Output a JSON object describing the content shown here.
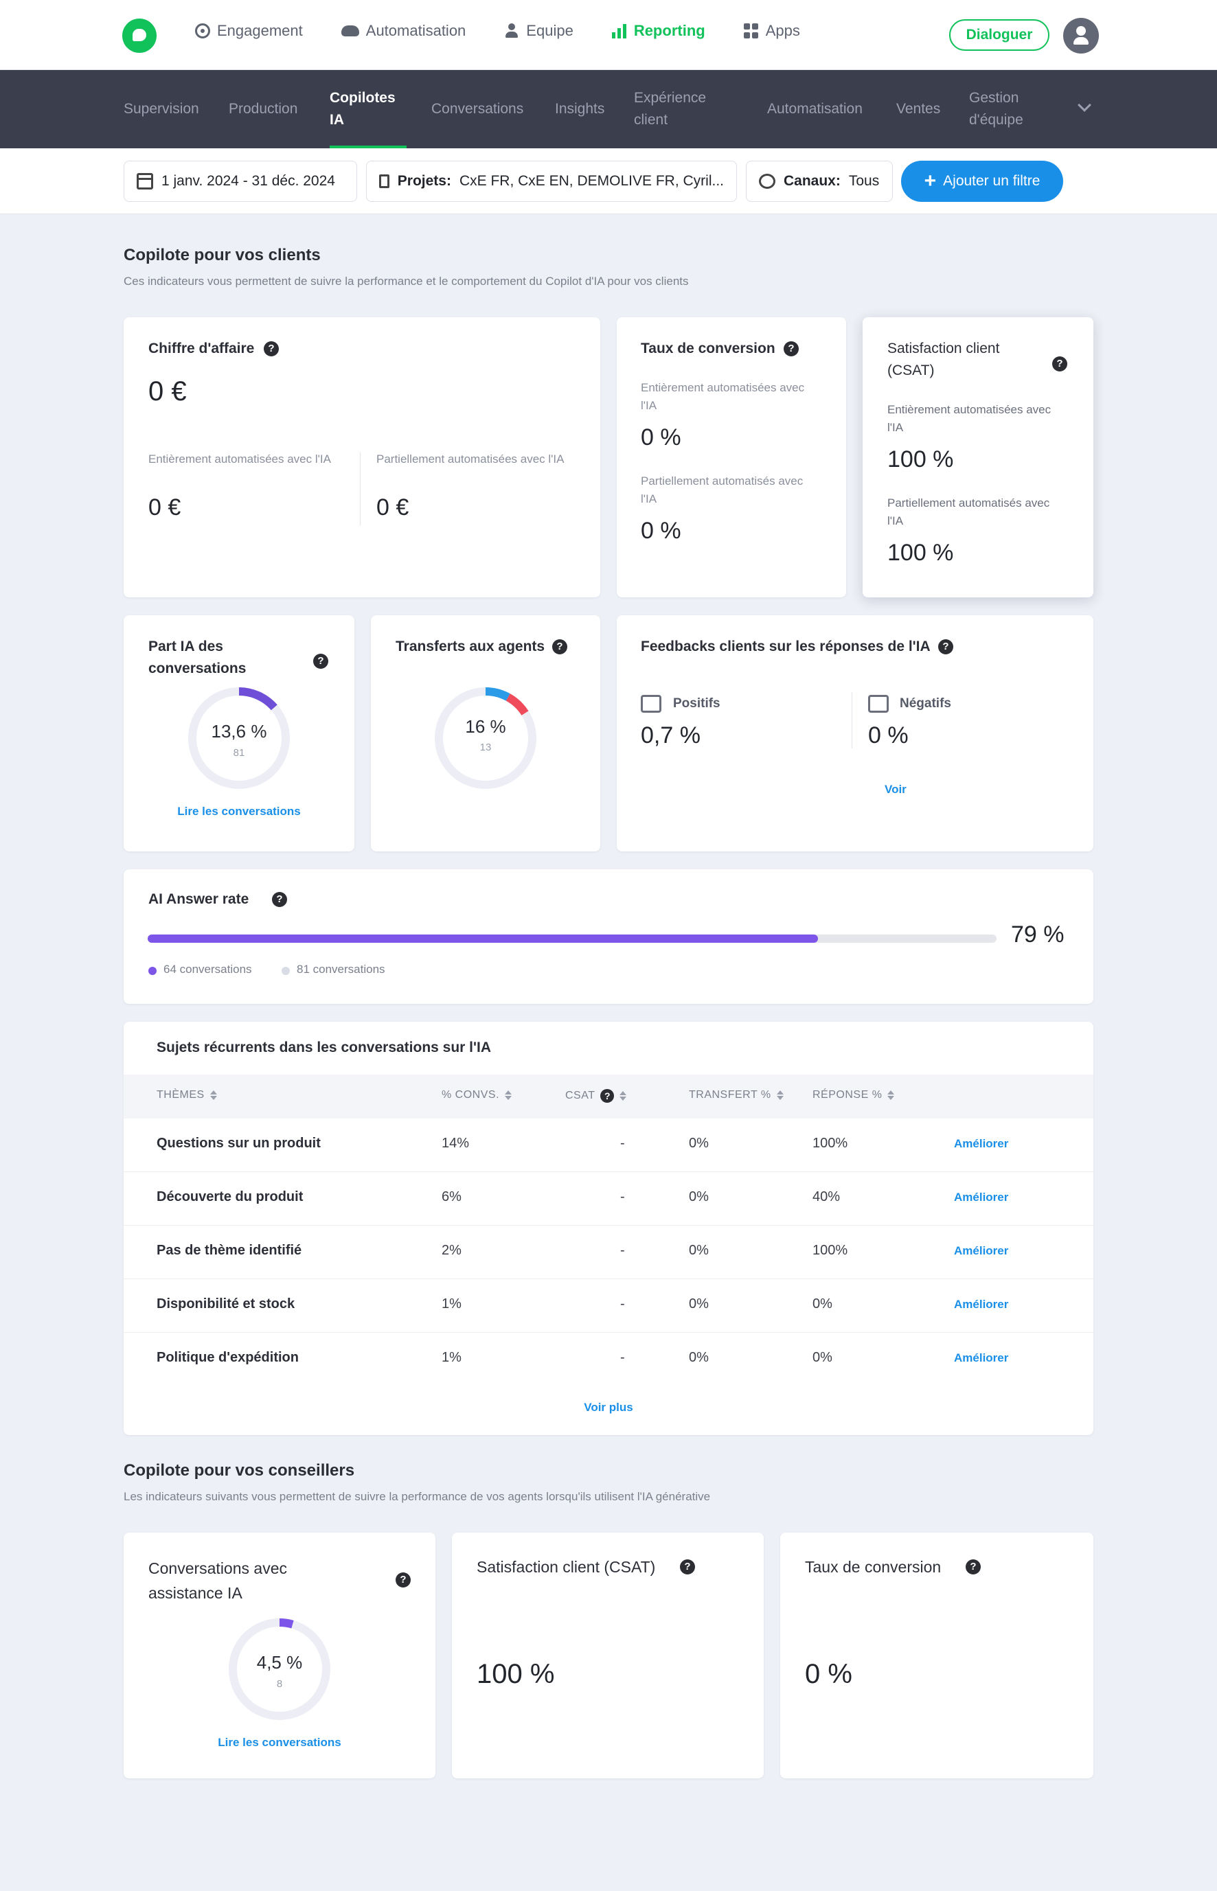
{
  "topnav": {
    "items": [
      {
        "label": "Engagement",
        "icon": "target-icon"
      },
      {
        "label": "Automatisation",
        "icon": "cloud-icon"
      },
      {
        "label": "Equipe",
        "icon": "user-icon"
      },
      {
        "label": "Reporting",
        "icon": "bar-chart-icon",
        "active": true
      },
      {
        "label": "Apps",
        "icon": "apps-grid-icon"
      }
    ],
    "dialoguer": "Dialoguer",
    "accent": "#11c25a"
  },
  "subnav": {
    "items": [
      {
        "label": "Supervision"
      },
      {
        "label": "Production"
      },
      {
        "label": "Copilotes IA",
        "active": true
      },
      {
        "label": "Conversations"
      },
      {
        "label": "Insights"
      },
      {
        "label": "Expérience client"
      },
      {
        "label": "Automatisation"
      },
      {
        "label": "Ventes"
      },
      {
        "label": "Gestion d'équipe"
      }
    ]
  },
  "filters": {
    "date": "1 janv. 2024 - 31 déc. 2024",
    "projects_label": "Projets:",
    "projects_value": "CxE FR, CxE EN, DEMOLIVE FR, Cyril...",
    "channels_label": "Canaux:",
    "channels_value": "Tous",
    "add": "Ajouter un filtre"
  },
  "clients": {
    "title": "Copilote pour vos clients",
    "subtitle": "Ces indicateurs vous permettent de suivre la performance et le comportement du Copilot d'IA pour vos clients",
    "revenue": {
      "title": "Chiffre d'affaire",
      "total": "0 €",
      "full_label": "Entièrement automatisées avec l'IA",
      "full_value": "0 €",
      "partial_label": "Partiellement automatisées avec l'IA",
      "partial_value": "0 €"
    },
    "conversion": {
      "title": "Taux de conversion",
      "full_label": "Entièrement automatisées avec l'IA",
      "full_value": "0 %",
      "partial_label": "Partiellement automatisés avec l'IA",
      "partial_value": "0 %"
    },
    "csat": {
      "title": "Satisfaction client (CSAT)",
      "full_label": "Entièrement automatisées avec l'IA",
      "full_value": "100 %",
      "partial_label": "Partiellement automatisés avec l'IA",
      "partial_value": "100 %"
    },
    "ai_share": {
      "title": "Part IA des conversations",
      "value": "13,6 %",
      "count": "81",
      "percent": 13.6,
      "color": "#6f4fd8",
      "link": "Lire les conversations"
    },
    "transfers": {
      "title": "Transferts aux agents",
      "value": "16 %",
      "count": "13",
      "segments": [
        {
          "percent": 8,
          "color": "#2b9be8"
        },
        {
          "percent": 8,
          "color": "#ef4b5a"
        }
      ]
    },
    "feedback": {
      "title": "Feedbacks clients sur les réponses de l'IA",
      "positive_label": "Positifs",
      "positive_value": "0,7 %",
      "negative_label": "Négatifs",
      "negative_value": "0 %",
      "link": "Voir"
    },
    "answer_rate": {
      "title": "AI Answer rate",
      "value": "79 %",
      "percent": 79,
      "legend_answered": "64 conversations",
      "legend_total": "81 conversations",
      "fill_color": "#7d55e8"
    }
  },
  "topics": {
    "title": "Sujets récurrents dans les conversations sur l'IA",
    "columns": [
      "THÈMES",
      "% CONVS.",
      "CSAT",
      "TRANSFERT %",
      "RÉPONSE %"
    ],
    "rows": [
      {
        "theme": "Questions sur un produit",
        "convs": "14%",
        "csat": "-",
        "transfer": "0%",
        "response": "100%",
        "action": "Améliorer"
      },
      {
        "theme": "Découverte du produit",
        "convs": "6%",
        "csat": "-",
        "transfer": "0%",
        "response": "40%",
        "action": "Améliorer"
      },
      {
        "theme": "Pas de thème identifié",
        "convs": "2%",
        "csat": "-",
        "transfer": "0%",
        "response": "100%",
        "action": "Améliorer"
      },
      {
        "theme": "Disponibilité et stock",
        "convs": "1%",
        "csat": "-",
        "transfer": "0%",
        "response": "0%",
        "action": "Améliorer"
      },
      {
        "theme": "Politique d'expédition",
        "convs": "1%",
        "csat": "-",
        "transfer": "0%",
        "response": "0%",
        "action": "Améliorer"
      }
    ],
    "more": "Voir plus"
  },
  "advisors": {
    "title": "Copilote pour vos conseillers",
    "subtitle": "Les indicateurs suivants vous permettent de suivre la performance de vos agents lorsqu'ils utilisent l'IA générative",
    "assisted": {
      "title": "Conversations avec assistance IA",
      "value": "4,5 %",
      "count": "8",
      "percent": 4.5,
      "color": "#7d55e8",
      "link": "Lire les conversations"
    },
    "csat": {
      "title": "Satisfaction client (CSAT)",
      "value": "100 %"
    },
    "conversion": {
      "title": "Taux de conversion",
      "value": "0 %"
    }
  }
}
